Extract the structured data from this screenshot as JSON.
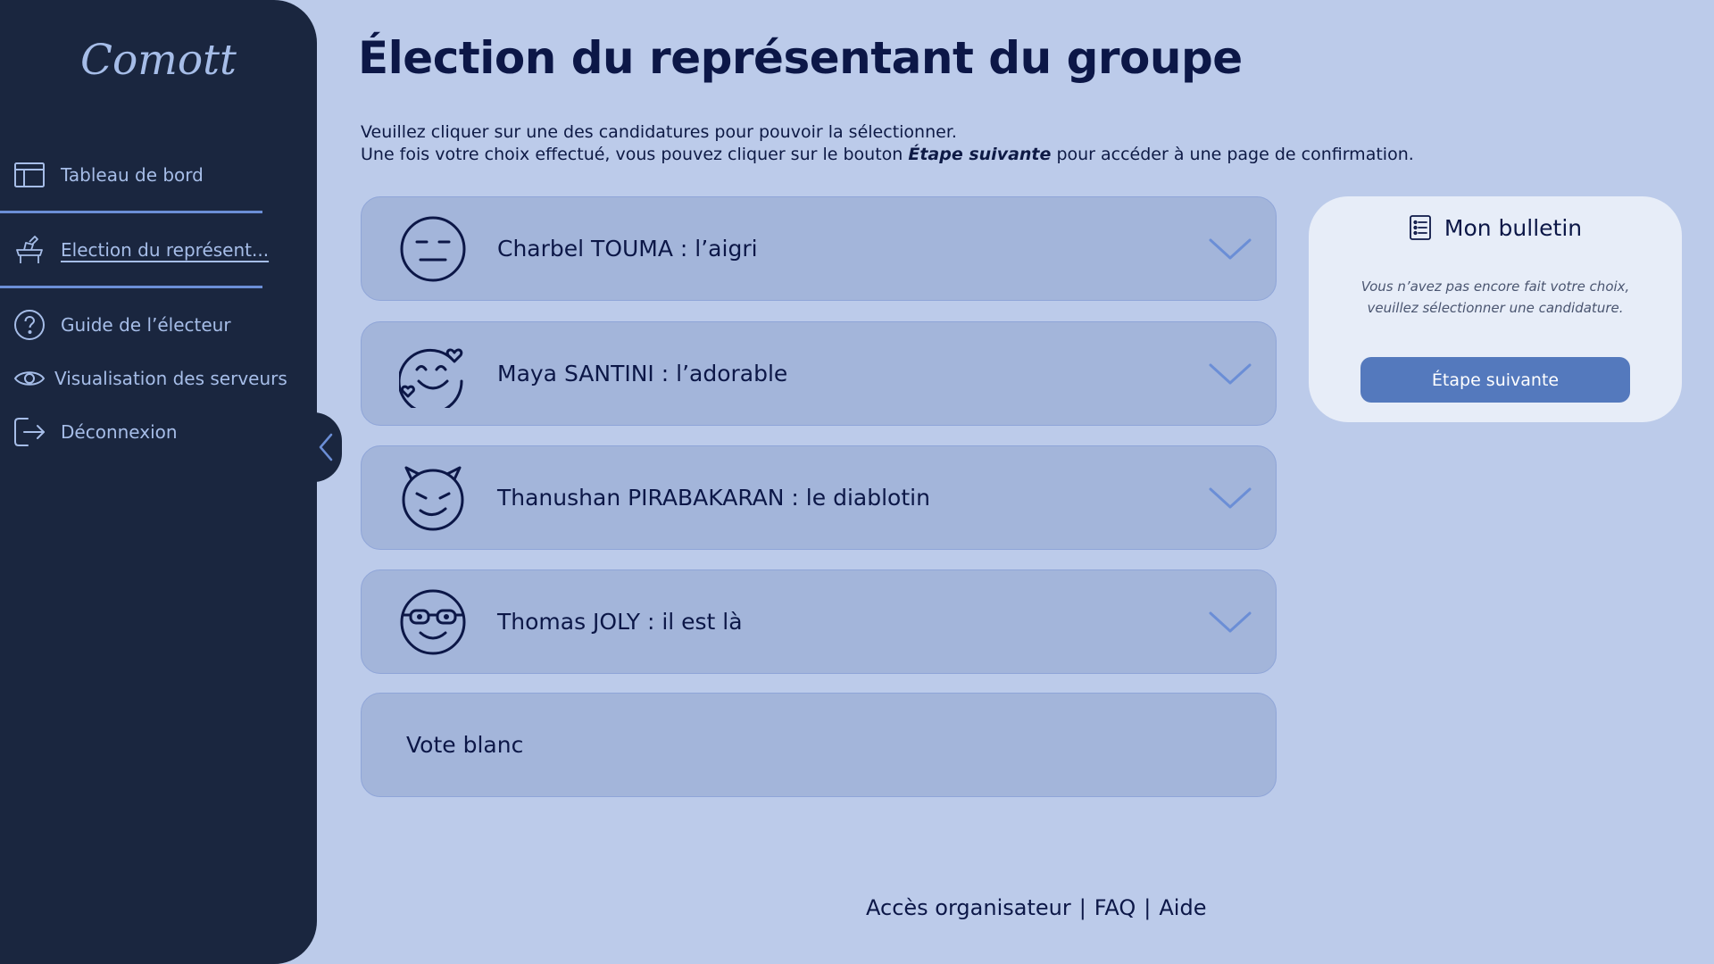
{
  "app": {
    "brand": "Comott"
  },
  "sidebar": {
    "items": [
      {
        "label": "Tableau de bord",
        "icon": "layout-icon"
      },
      {
        "label": "Election du représent...",
        "icon": "ballot-box-icon",
        "active": true
      },
      {
        "label": "Guide de l’électeur",
        "icon": "help-circle-icon"
      },
      {
        "label": "Visualisation des serveurs",
        "icon": "eye-icon"
      },
      {
        "label": "Déconnexion",
        "icon": "logout-icon"
      }
    ]
  },
  "main": {
    "title": "Élection du représentant du groupe",
    "instructions": {
      "line1": "Veuillez cliquer sur une des candidatures pour pouvoir la sélectionner.",
      "line2_before": "Une fois votre choix effectué, vous pouvez cliquer sur le bouton ",
      "line2_emph": "Étape suivante",
      "line2_after": " pour accéder à une page de confirmation."
    },
    "candidates": [
      {
        "name": "Charbel TOUMA",
        "tagline": " : l’aigri",
        "icon": "neutral-face-icon"
      },
      {
        "name": "Maya SANTINI",
        "tagline": " : l’adorable",
        "icon": "smiling-face-hearts-icon"
      },
      {
        "name": "Thanushan PIRABAKARAN",
        "tagline": " : le diablotin",
        "icon": "devil-face-icon"
      },
      {
        "name": "Thomas JOLY",
        "tagline": " : il est là",
        "icon": "glasses-face-icon"
      }
    ],
    "blank_vote": "Vote blanc"
  },
  "ballot": {
    "title": "Mon bulletin",
    "message_line1": "Vous n’avez pas encore fait votre choix,",
    "message_line2": "veuillez sélectionner une candidature.",
    "next_button": "Étape suivante"
  },
  "footer": {
    "organizer": "Accès organisateur",
    "faq": "FAQ",
    "help": "Aide",
    "separator": "|"
  },
  "colors": {
    "background": "#bccbea",
    "sidebar": "#1a263f",
    "sidebar_text": "#a6bde8",
    "card": "#a3b5da",
    "primary_button": "#5479bd",
    "title": "#0c1747"
  }
}
